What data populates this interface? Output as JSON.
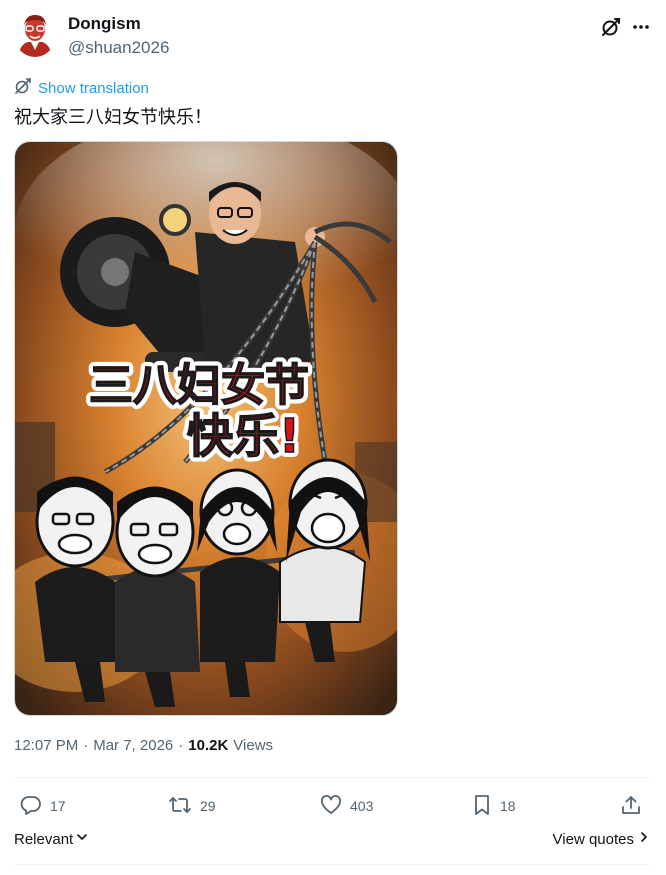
{
  "tweet": {
    "author_name": "Dongism",
    "author_handle": "@shuan2026",
    "translate_label": "Show translation",
    "text": "祝大家三八妇女节快乐！",
    "image_text_line1": "三八妇女节",
    "image_text_line2": "快乐!",
    "time": "12:07 PM",
    "separator": "·",
    "date": "Mar 7, 2026",
    "views_count": "10.2K",
    "views_label": "Views"
  },
  "actions": {
    "replies": "17",
    "reposts": "29",
    "likes": "403",
    "bookmarks": "18"
  },
  "sort": {
    "label": "Relevant"
  },
  "quotes": {
    "label": "View quotes"
  },
  "icons": {
    "grok": "grok-slash-icon",
    "more": "more-horizontal-icon",
    "translate": "translate-icon",
    "reply": "reply-icon",
    "repost": "repost-icon",
    "like": "heart-icon",
    "bookmark": "bookmark-icon",
    "share": "share-icon"
  },
  "colors": {
    "link_blue": "#1d9bf0",
    "secondary_text": "#536471",
    "primary_text": "#0f1419",
    "poster_red": "#d7141a"
  }
}
